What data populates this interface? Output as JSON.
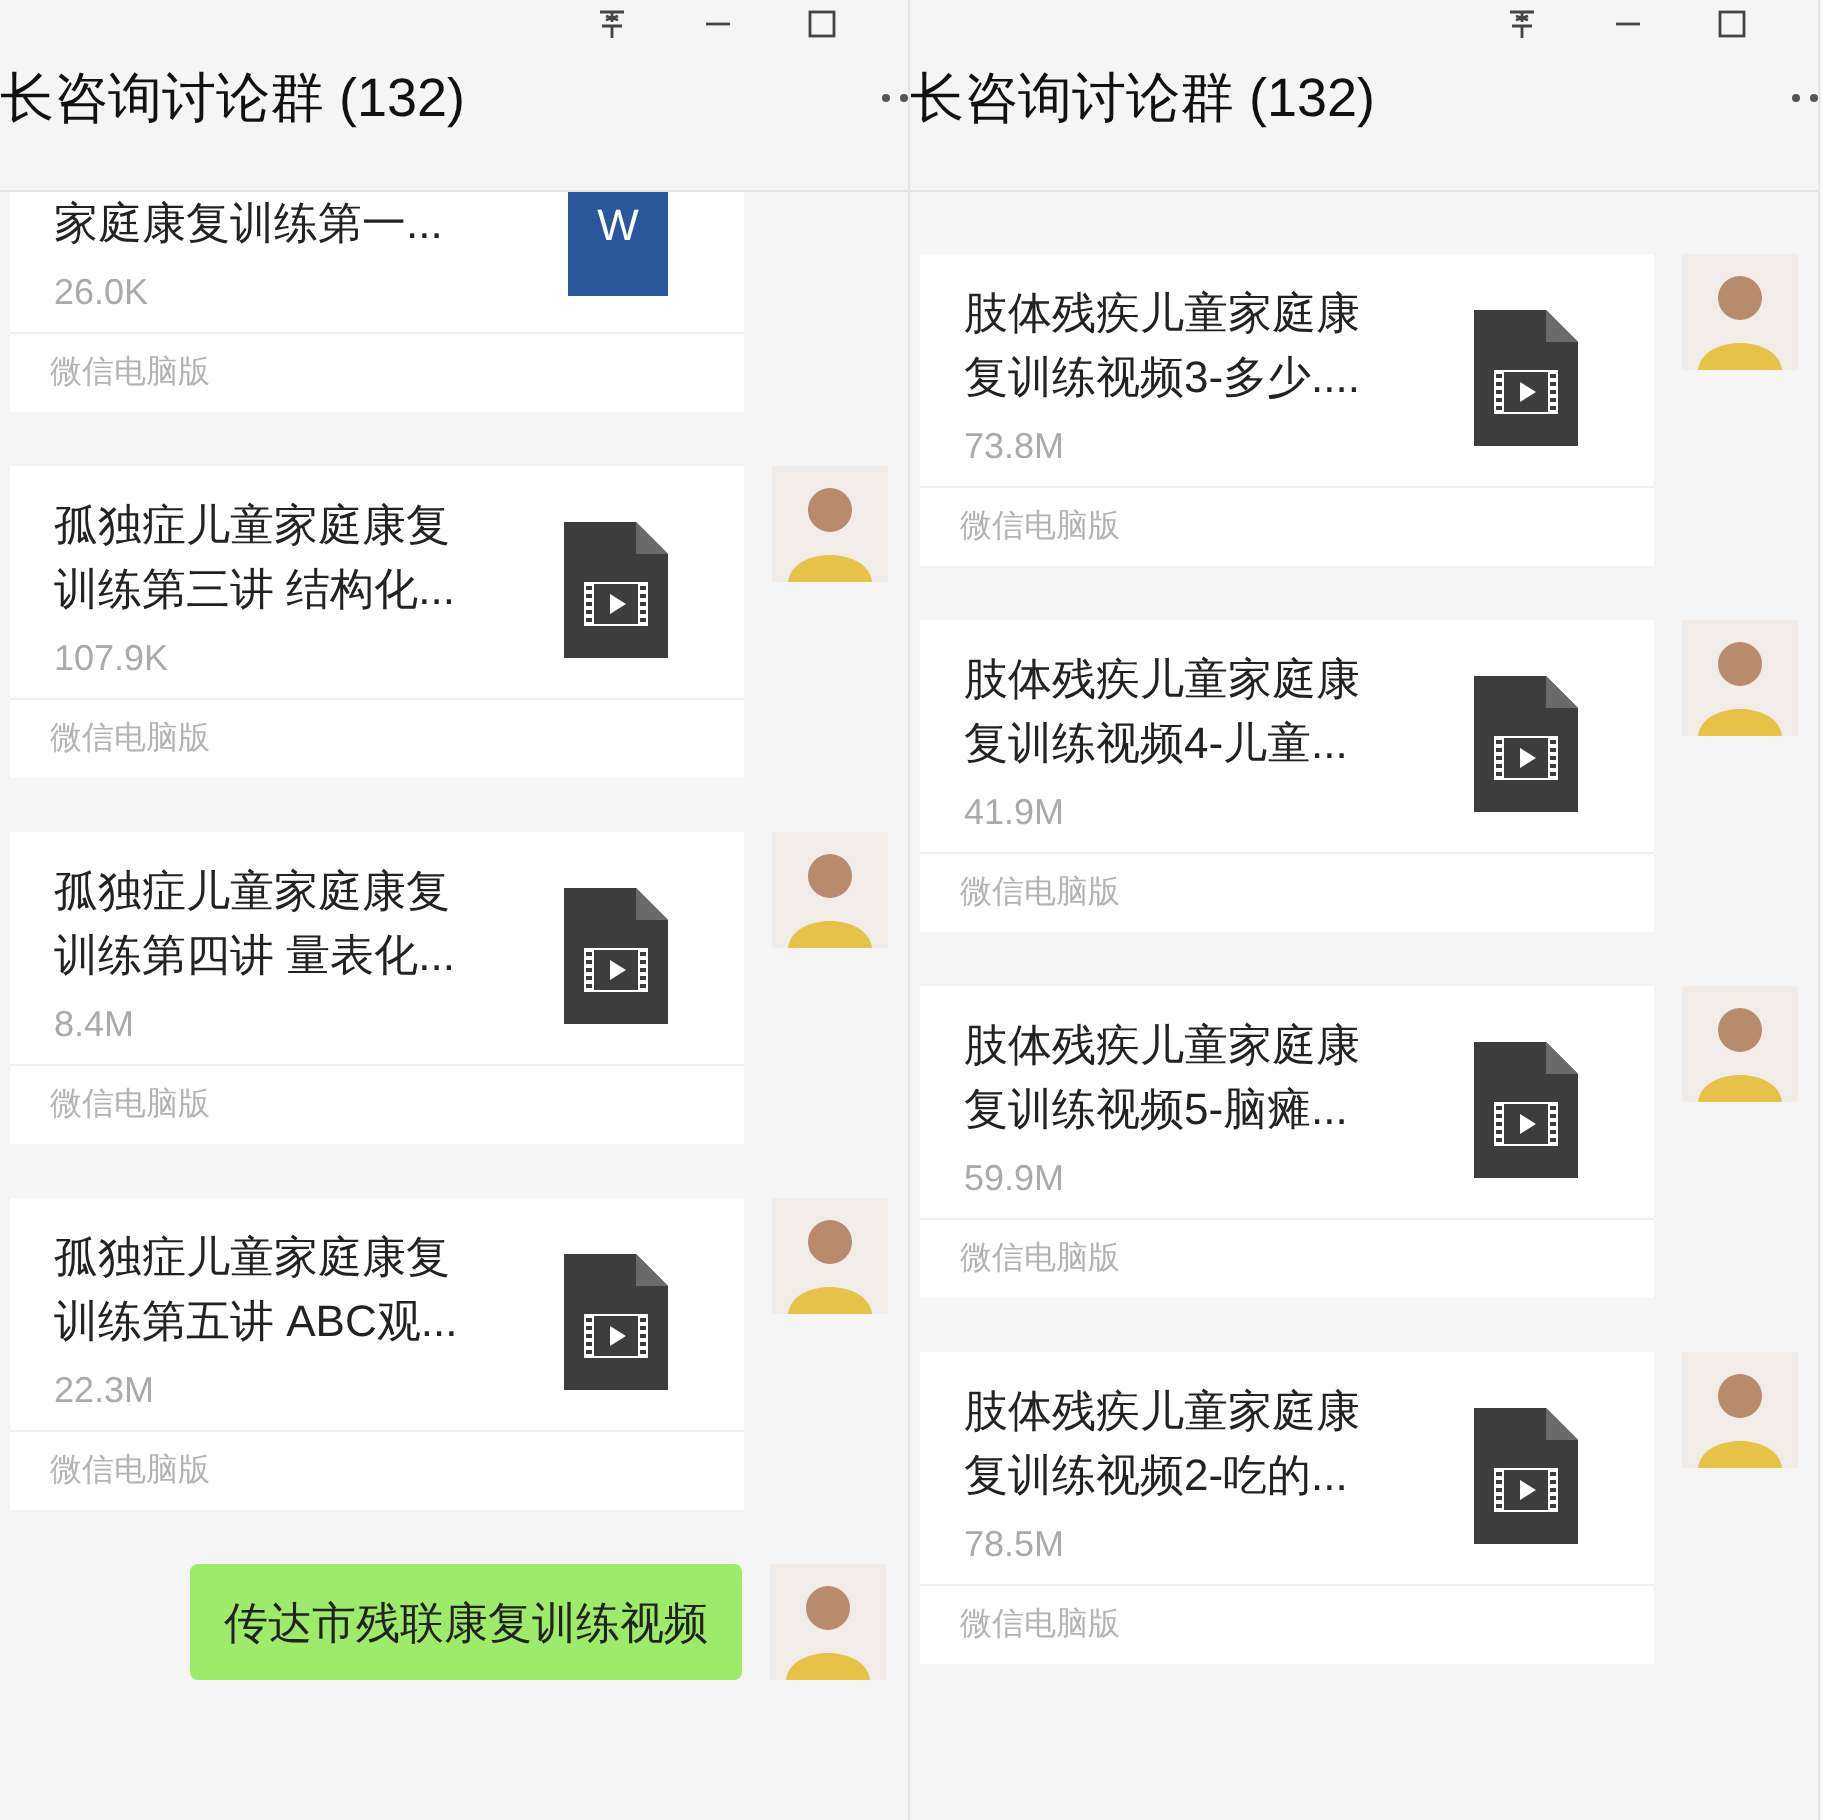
{
  "panes": [
    {
      "title": "长咨询讨论群 (132)",
      "messages": [
        {
          "kind": "file",
          "partial": true,
          "icon": {
            "kind": "word",
            "label": "W"
          },
          "lines": [
            "家庭康复训练第一..."
          ],
          "size": "26.0K",
          "source": "微信电脑版"
        },
        {
          "kind": "file",
          "partial": false,
          "icon": {
            "kind": "video"
          },
          "lines": [
            "孤独症儿童家庭康复",
            "训练第三讲 结构化..."
          ],
          "size": "107.9K",
          "source": "微信电脑版"
        },
        {
          "kind": "file",
          "partial": false,
          "icon": {
            "kind": "video"
          },
          "lines": [
            "孤独症儿童家庭康复",
            "训练第四讲 量表化..."
          ],
          "size": "8.4M",
          "source": "微信电脑版"
        },
        {
          "kind": "file",
          "partial": false,
          "icon": {
            "kind": "video"
          },
          "lines": [
            "孤独症儿童家庭康复",
            "训练第五讲 ABC观..."
          ],
          "size": "22.3M",
          "source": "微信电脑版"
        },
        {
          "kind": "text",
          "text": "传达市残联康复训练视频"
        }
      ]
    },
    {
      "title": "长咨询讨论群 (132)",
      "messages": [
        {
          "kind": "file",
          "partial": false,
          "icon": {
            "kind": "video"
          },
          "lines": [
            "肢体残疾儿童家庭康",
            "复训练视频3-多少...."
          ],
          "size": "73.8M",
          "source": "微信电脑版"
        },
        {
          "kind": "file",
          "partial": false,
          "icon": {
            "kind": "video"
          },
          "lines": [
            "肢体残疾儿童家庭康",
            "复训练视频4-儿童..."
          ],
          "size": "41.9M",
          "source": "微信电脑版"
        },
        {
          "kind": "file",
          "partial": false,
          "icon": {
            "kind": "video"
          },
          "lines": [
            "肢体残疾儿童家庭康",
            "复训练视频5-脑瘫..."
          ],
          "size": "59.9M",
          "source": "微信电脑版"
        },
        {
          "kind": "file",
          "partial": false,
          "icon": {
            "kind": "video"
          },
          "lines": [
            "肢体残疾儿童家庭康",
            "复训练视频2-吃的..."
          ],
          "size": "78.5M",
          "source": "微信电脑版"
        }
      ]
    }
  ]
}
